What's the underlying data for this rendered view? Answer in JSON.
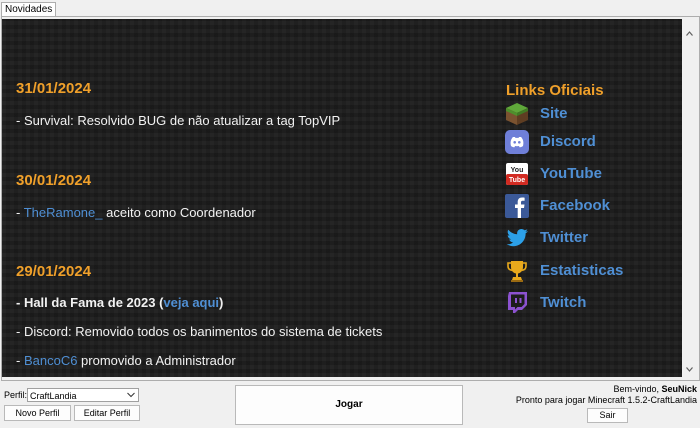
{
  "tab": {
    "label": "Novidades"
  },
  "news": [
    {
      "date": "31/01/2024",
      "lines": [
        {
          "text": "- Survival: Resolvido BUG de não atualizar a tag TopVIP"
        }
      ]
    },
    {
      "date": "30/01/2024",
      "lines": [
        {
          "prefix": "- ",
          "link": "TheRamone_",
          "suffix": " aceito como Coordenador"
        }
      ]
    },
    {
      "date": "29/01/2024",
      "lines": [
        {
          "prefix": "- Hall da Fama de 2023 (",
          "link": "veja aqui",
          "suffix": ")"
        },
        {
          "text": "- Discord: Removido todos os banimentos do sistema de tickets"
        },
        {
          "prefix": "- ",
          "link": "BancoC6",
          "suffix": " promovido a Administrador"
        }
      ]
    }
  ],
  "links_panel": {
    "title": "Links Oficiais",
    "items": [
      {
        "label": "Site",
        "icon": "minecraft-grass-block-icon"
      },
      {
        "label": "Discord",
        "icon": "discord-icon"
      },
      {
        "label": "YouTube",
        "icon": "youtube-icon"
      },
      {
        "label": "Facebook",
        "icon": "facebook-icon"
      },
      {
        "label": "Twitter",
        "icon": "twitter-icon"
      },
      {
        "label": "Estatisticas",
        "icon": "trophy-icon"
      },
      {
        "label": "Twitch",
        "icon": "twitch-icon"
      }
    ]
  },
  "footer": {
    "profile_label": "Perfil:",
    "profile_value": "CraftLandia",
    "new_profile": "Novo Perfil",
    "edit_profile": "Editar Perfil",
    "play": "Jogar",
    "welcome_prefix": "Bem-vindo, ",
    "username": "SeuNick",
    "ready_text": "Pronto para jogar Minecraft 1.5.2-CraftLandia",
    "logout": "Sair"
  },
  "colors": {
    "date": "#f0a02a",
    "link": "#4f8fd4",
    "news_background": "#1c1c1c"
  }
}
